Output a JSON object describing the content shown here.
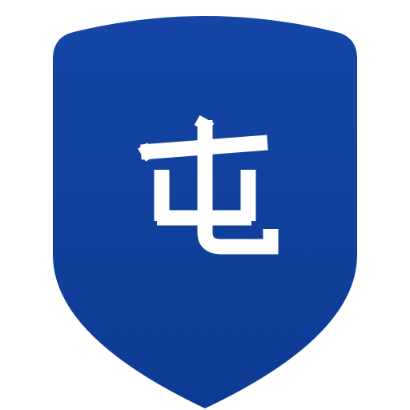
{
  "app_icon": {
    "name": "shield-character-icon",
    "character": "屯",
    "colors": {
      "shield_top": "#1546A6",
      "shield_bottom": "#0D3B93",
      "character": "#FFFFFF",
      "background": "#FFFFFF"
    }
  }
}
